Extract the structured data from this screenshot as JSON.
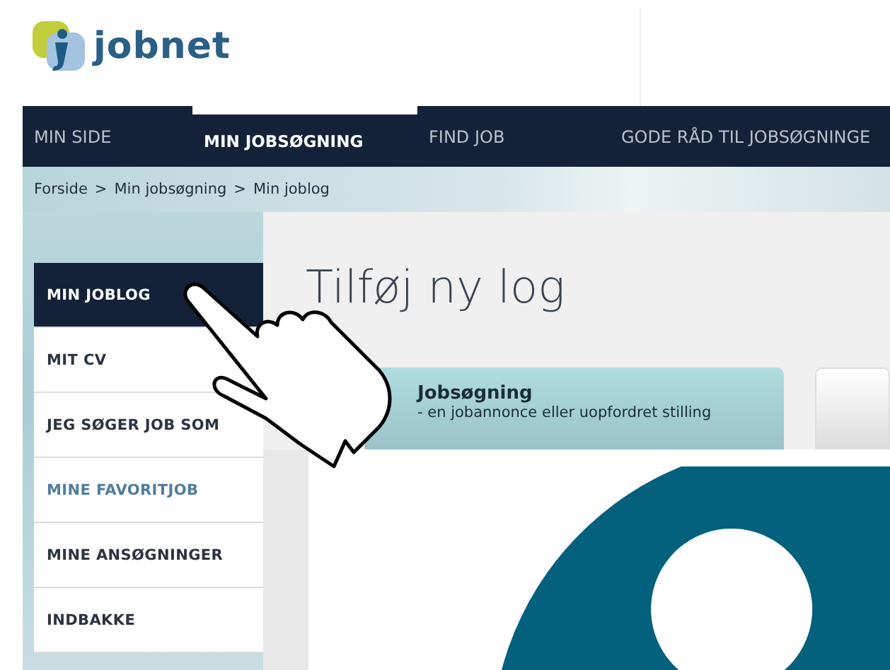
{
  "logo": {
    "text": "jobnet"
  },
  "nav": [
    {
      "label": "MIN SIDE",
      "selected": false
    },
    {
      "label": "MIN JOBSØGNING",
      "selected": true
    },
    {
      "label": "FIND JOB",
      "selected": false
    },
    {
      "label": "GODE RÅD TIL JOBSØGNINGE",
      "selected": false
    }
  ],
  "breadcrumb": {
    "separator": ">",
    "items": [
      "Forside",
      "Min jobsøgning",
      "Min joblog"
    ]
  },
  "sidebar": {
    "items": [
      {
        "label": "MIN JOBLOG",
        "selected": true,
        "highlighted": false
      },
      {
        "label": "MIT CV",
        "selected": false,
        "highlighted": false
      },
      {
        "label": "JEG SØGER JOB SOM",
        "selected": false,
        "highlighted": false
      },
      {
        "label": "MINE FAVORITJOB",
        "selected": false,
        "highlighted": true
      },
      {
        "label": "MINE ANSØGNINGER",
        "selected": false,
        "highlighted": false
      },
      {
        "label": "INDBAKKE",
        "selected": false,
        "highlighted": false
      }
    ]
  },
  "main": {
    "title": "Tilføj ny log",
    "cards": [
      {
        "title": "Jobsøgning",
        "subtitle": "- en jobannonce eller uopfordret stilling",
        "selected": true
      },
      {
        "selected": false
      }
    ]
  }
}
